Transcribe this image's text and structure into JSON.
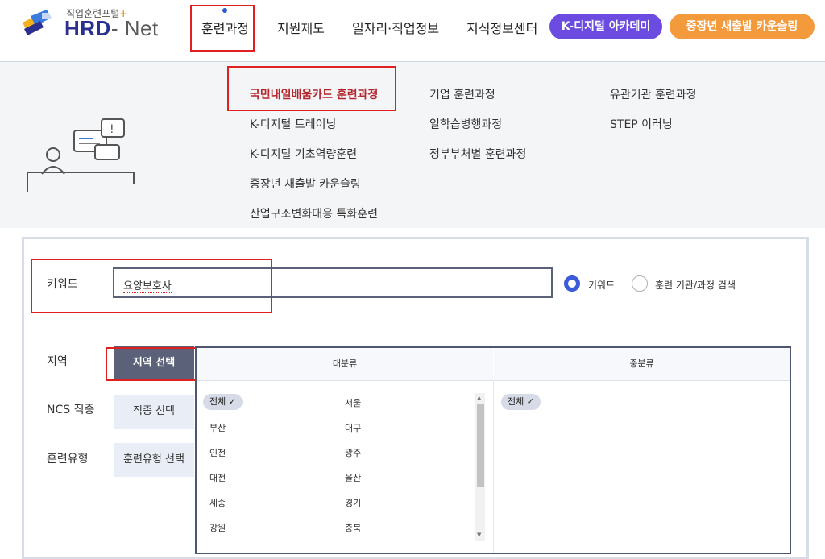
{
  "header": {
    "logo_sub": "직업훈련포털",
    "logo_plus": "+",
    "logo_hrd": "HRD",
    "logo_net": "- Net",
    "nav": [
      "훈련과정",
      "지원제도",
      "일자리·직업정보",
      "지식정보센터"
    ],
    "pill_digital": "K-디지털 아카데미",
    "pill_counsel": "중장년 새출발 카운슬링"
  },
  "menu": {
    "col1": [
      "국민내일배움카드 훈련과정",
      "K-디지털 트레이닝",
      "K-디지털 기초역량훈련",
      "중장년 새출발 카운슬링",
      "산업구조변화대응 특화훈련"
    ],
    "col2": [
      "기업 훈련과정",
      "일학습병행과정",
      "정부부처별 훈련과정"
    ],
    "col3": [
      "유관기관 훈련과정",
      "STEP 이러닝"
    ]
  },
  "search": {
    "keyword_label": "키워드",
    "keyword_value": "요양보호사",
    "radio_keyword": "키워드",
    "radio_org": "훈련 기관/과정 검색",
    "region_label": "지역",
    "region_btn": "지역 선택",
    "ncs_label": "NCS 직종",
    "ncs_btn": "직종 선택",
    "type_label": "훈련유형",
    "type_btn": "훈련유형 선택",
    "major_head": "대분류",
    "minor_head": "중분류",
    "all_chip": "전체",
    "regions_left": [
      "부산",
      "인천",
      "대전",
      "세종",
      "강원"
    ],
    "regions_right": [
      "서울",
      "대구",
      "광주",
      "울산",
      "경기",
      "충북"
    ]
  },
  "colors": {
    "accent_red": "#e02020",
    "pill_digital": "#6c4ce0",
    "pill_counsel": "#f39a3c",
    "menu_active": "#b3262e"
  }
}
